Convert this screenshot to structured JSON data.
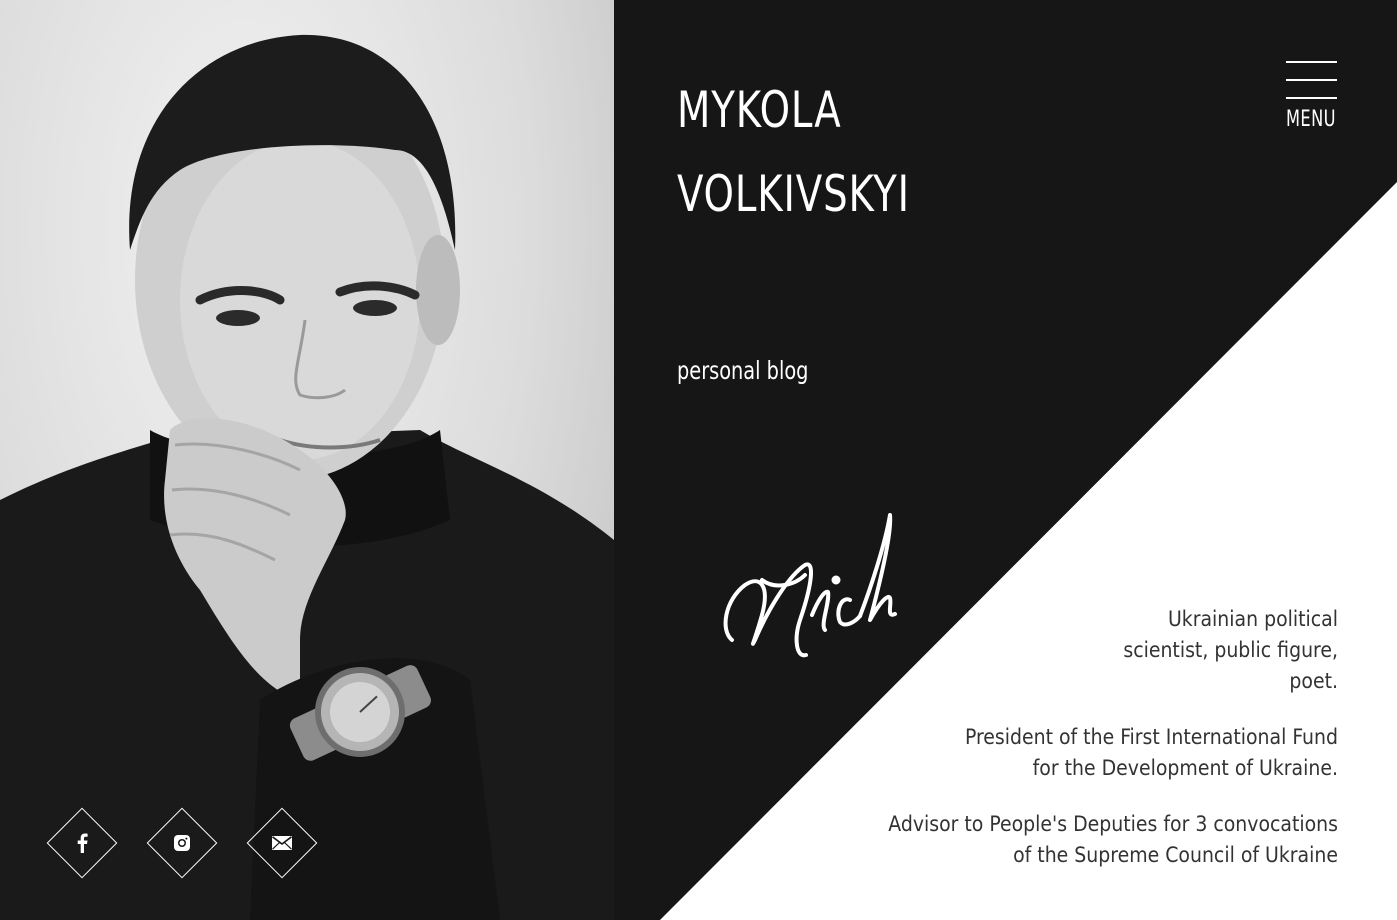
{
  "header": {
    "name_line1": "MYKOLA",
    "name_line2": "VOLKIVSKYI",
    "subtitle": "personal blog",
    "menu_label": "MENU"
  },
  "signature": "Nich",
  "bio": {
    "p1": [
      "Ukrainian political",
      "scientist, public figure,",
      "poet."
    ],
    "p2": [
      "President of the First International Fund",
      "for the Development of Ukraine."
    ],
    "p3": [
      "Advisor to People's Deputies for 3 convocations",
      "of the Supreme Council of Ukraine"
    ]
  },
  "social": [
    {
      "icon": "facebook-icon"
    },
    {
      "icon": "instagram-icon"
    },
    {
      "icon": "mail-icon"
    }
  ],
  "colors": {
    "dark": "#161616",
    "light": "#ffffff",
    "bio_text": "#333333"
  }
}
